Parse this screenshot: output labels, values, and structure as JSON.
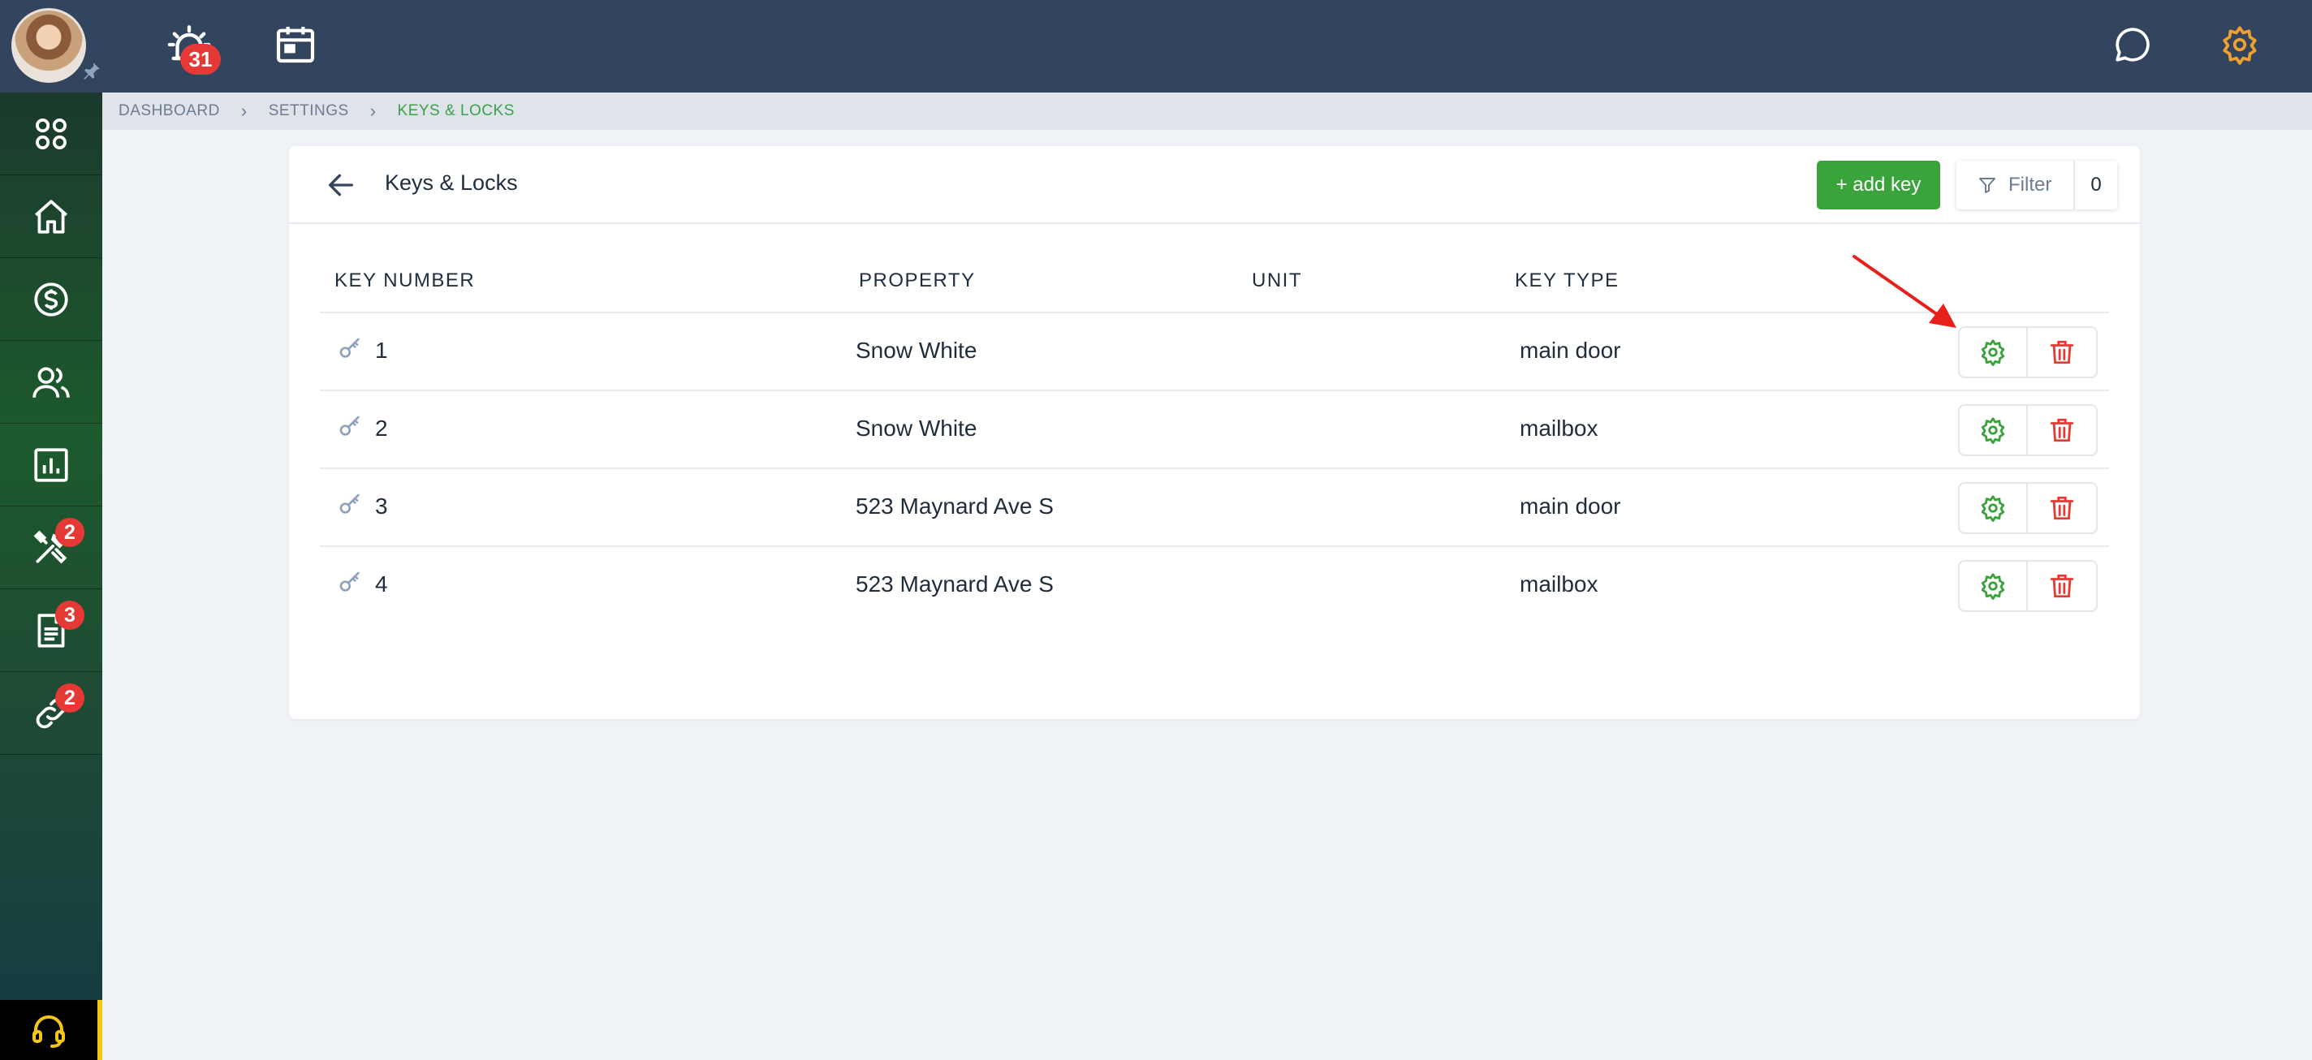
{
  "topbar": {
    "notification_count": "31",
    "icons": [
      "avatar",
      "pin-icon",
      "alarm-icon",
      "calendar-icon",
      "chat-icon",
      "settings-gear-icon"
    ]
  },
  "sidebar": {
    "items": [
      {
        "name": "apps-grid-icon",
        "badge": ""
      },
      {
        "name": "home-icon",
        "badge": ""
      },
      {
        "name": "dollar-icon",
        "badge": ""
      },
      {
        "name": "users-icon",
        "badge": ""
      },
      {
        "name": "reports-chart-icon",
        "badge": ""
      },
      {
        "name": "tools-icon",
        "badge": "2"
      },
      {
        "name": "document-icon",
        "badge": "3"
      },
      {
        "name": "link-icon",
        "badge": "2"
      }
    ],
    "support_icon": "headset-icon"
  },
  "breadcrumb": {
    "items": [
      "DASHBOARD",
      "SETTINGS",
      "KEYS & LOCKS"
    ]
  },
  "page": {
    "title": "Keys & Locks",
    "add_key_label": "+ add key",
    "filter_label": "Filter",
    "filter_count": "0"
  },
  "table": {
    "headers": [
      "KEY NUMBER",
      "PROPERTY",
      "UNIT",
      "KEY TYPE"
    ],
    "rows": [
      {
        "key_number": "1",
        "property": "Snow White",
        "unit": "",
        "key_type": "main door"
      },
      {
        "key_number": "2",
        "property": "Snow White",
        "unit": "",
        "key_type": "mailbox"
      },
      {
        "key_number": "3",
        "property": "523 Maynard Ave S",
        "unit": "",
        "key_type": "main door"
      },
      {
        "key_number": "4",
        "property": "523 Maynard Ave S",
        "unit": "",
        "key_type": "mailbox"
      }
    ]
  },
  "colors": {
    "topbar": "#33445e",
    "accent_green": "#3aa33c",
    "danger_red": "#e53935",
    "settings_orange": "#f0a030",
    "annotation_arrow": "#e8201c"
  }
}
